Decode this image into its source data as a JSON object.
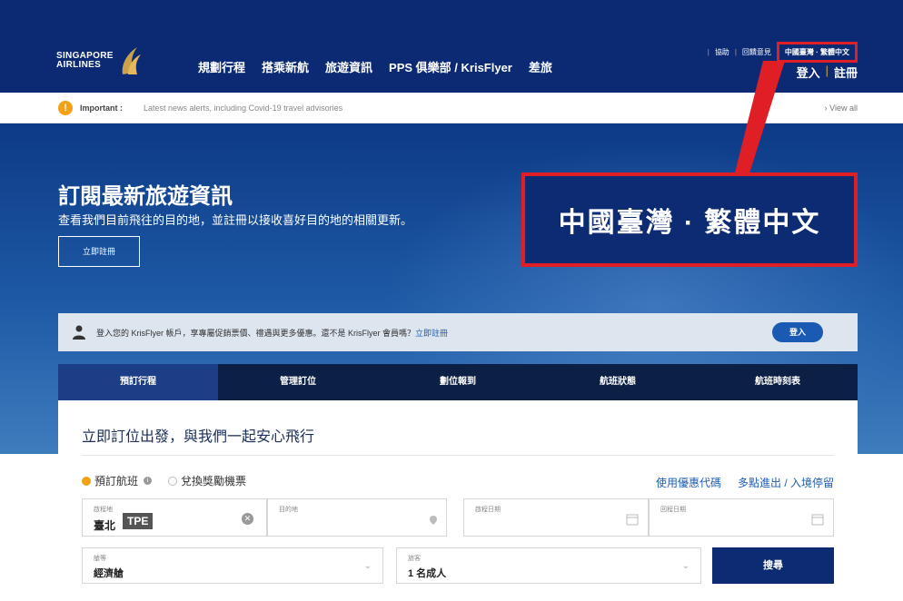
{
  "header": {
    "logo_line1": "SINGAPORE",
    "logo_line2": "AIRLINES",
    "nav": [
      "規劃行程",
      "搭乘新航",
      "旅遊資訊",
      "PPS 俱樂部 / KrisFlyer",
      "差旅"
    ],
    "help": "協助",
    "feedback": "回饋意見",
    "language": "中國臺灣 · 繁體中文",
    "login": "登入",
    "register": "註冊"
  },
  "alert": {
    "title": "Important :",
    "text": "Latest news alerts, including Covid-19 travel advisories",
    "view_all": "› View all"
  },
  "hero": {
    "title": "訂閱最新旅遊資訊",
    "subtitle": "查看我們目前飛往的目的地，並註冊以接收喜好目的地的相關更新。",
    "button": "立即註冊"
  },
  "callout": {
    "text": "中國臺灣 · 繁體中文"
  },
  "login_bar": {
    "text": "登入您的 KrisFlyer 帳戶，享專屬促銷票價、禮遇與更多優惠。還不是 KrisFlyer 會員嗎？",
    "link": "立即註冊",
    "button": "登入"
  },
  "tabs": [
    "預訂行程",
    "管理訂位",
    "劃位報到",
    "航班狀態",
    "航班時刻表"
  ],
  "booking": {
    "title": "立即訂位出發，與我們一起安心飛行",
    "radio_book": "預訂航班",
    "radio_redeem": "兌換獎勵機票",
    "promo_link": "使用優惠代碼",
    "multi_link": "多點進出 / 入境停留",
    "from_label": "啟程地",
    "from_value": "臺北",
    "from_code": "TPE",
    "to_label": "目的地",
    "depart_label": "啟程日期",
    "return_label": "回程日期",
    "class_label": "艙等",
    "class_value": "經濟艙",
    "pax_label": "旅客",
    "pax_value": "1 名成人",
    "search": "搜尋"
  },
  "colors": {
    "header_bg": "#0b2a73",
    "accent_gold": "#c9a24b",
    "highlight_red": "#e01e26",
    "alert_orange": "#f3a218",
    "tab_bg": "#0c1f45",
    "link_blue": "#1f5db0"
  }
}
